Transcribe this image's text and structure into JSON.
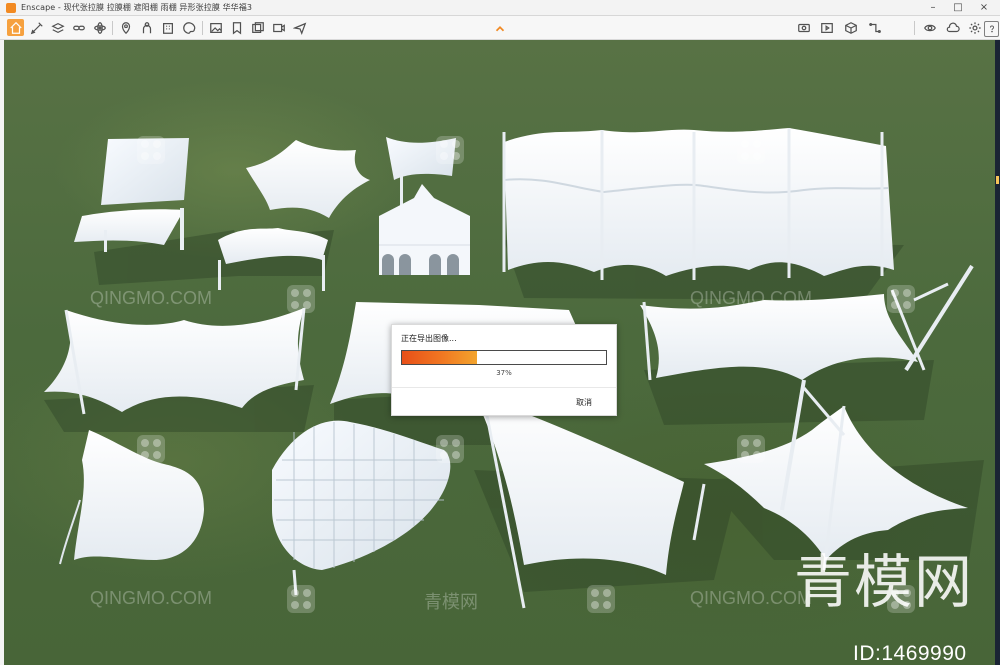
{
  "window": {
    "title": "Enscape - 现代张拉膜 拉膜棚 遮阳棚 雨棚 异形张拉膜 华华福3",
    "controls": {
      "minimize": "–",
      "maximize": "□",
      "close": "×"
    }
  },
  "toolbar": {
    "left_icons": [
      "home-icon",
      "draw-icon",
      "layers-icon",
      "link-icon",
      "atom-icon",
      "location-icon",
      "person-icon",
      "building-icon",
      "palette-icon",
      "image-icon",
      "bookmark-icon",
      "gallery-icon",
      "video-icon",
      "send-icon"
    ],
    "center_icon": "chevron-up-icon",
    "right_icons": [
      "panorama-icon",
      "media-icon",
      "box-icon",
      "eye-icon",
      "cloud-icon",
      "settings-icon",
      "help-icon"
    ],
    "active_icon": "home-icon",
    "accent_color": "#f6a13f"
  },
  "viewport": {
    "watermark_text": "QINGMO.COM",
    "watermark_cn": "青模网",
    "brand_text": "青模网",
    "id_text": "ID:1469990",
    "colors": {
      "grass": "#507040",
      "membrane": "#f4f7fb",
      "shadow": "#2f4427"
    }
  },
  "dialog": {
    "title": "正在导出图像...",
    "progress_percent": 37,
    "progress_label": "37%",
    "cancel_label": "取消",
    "progress_colors": {
      "start": "#e84f18",
      "end": "#f3a42d"
    }
  }
}
